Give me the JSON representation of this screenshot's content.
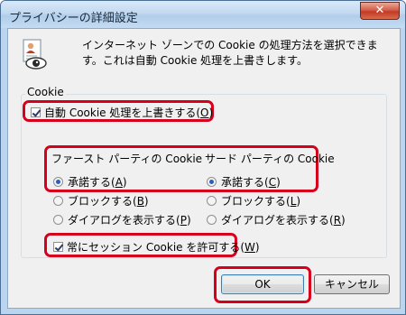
{
  "window": {
    "title": "プライバシーの詳細設定",
    "close_symbol": "✕"
  },
  "description": "インターネット ゾーンでの Cookie の処理方法を選択できます。これは自動 Cookie 処理を上書きします。",
  "group": {
    "label": "Cookie"
  },
  "override": {
    "label": "自動 Cookie 処理を上書きする(",
    "key": "O",
    "suffix": ")",
    "checked": true
  },
  "first_party": {
    "heading": "ファースト パーティの Cookie",
    "options": [
      {
        "label": "承諾する(",
        "key": "A",
        "suffix": ")",
        "selected": true
      },
      {
        "label": "ブロックする(",
        "key": "B",
        "suffix": ")",
        "selected": false
      },
      {
        "label": "ダイアログを表示する(",
        "key": "P",
        "suffix": ")",
        "selected": false
      }
    ]
  },
  "third_party": {
    "heading": "サード パーティの Cookie",
    "options": [
      {
        "label": "承諾する(",
        "key": "C",
        "suffix": ")",
        "selected": true
      },
      {
        "label": "ブロックする(",
        "key": "L",
        "suffix": ")",
        "selected": false
      },
      {
        "label": "ダイアログを表示する(",
        "key": "R",
        "suffix": ")",
        "selected": false
      }
    ]
  },
  "session": {
    "label": "常にセッション Cookie を許可する(",
    "key": "W",
    "suffix": ")",
    "checked": true
  },
  "buttons": {
    "ok": "OK",
    "cancel": "キャンセル"
  },
  "icons": {
    "privacy": "privacy-certificate-icon",
    "close": "close-icon"
  },
  "colors": {
    "highlight": "#d6001c",
    "titlebar": "#c2d9f1"
  }
}
